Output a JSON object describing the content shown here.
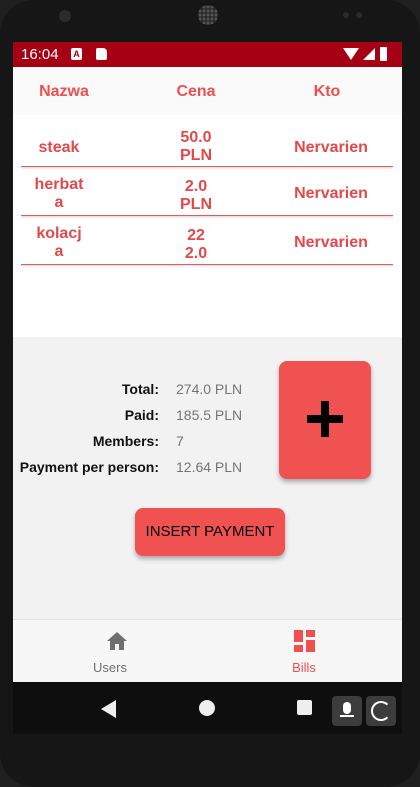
{
  "status_bar": {
    "time": "16:04"
  },
  "table": {
    "headers": [
      "Nazwa",
      "Cena",
      "Kto"
    ],
    "rows": [
      {
        "name_l1": "steak",
        "name_l2": "",
        "price_l1": "50.0",
        "price_l2": "PLN",
        "who": "Nervarien"
      },
      {
        "name_l1": "herbat",
        "name_l2": "a",
        "price_l1": "2.0",
        "price_l2": "PLN",
        "who": "Nervarien"
      },
      {
        "name_l1": "kolacj",
        "name_l2": "a",
        "price_l1": "22",
        "price_l2": "2.0",
        "who": "Nervarien"
      }
    ]
  },
  "summary": {
    "total_label": "Total:",
    "total_value": "274.0 PLN",
    "paid_label": "Paid:",
    "paid_value": "185.5 PLN",
    "members_label": "Members:",
    "members_value": "7",
    "per_person_label": "Payment per person:",
    "per_person_value": "12.64 PLN"
  },
  "buttons": {
    "add_icon": "plus-icon",
    "insert_label": "INSERT PAYMENT"
  },
  "bottom_nav": {
    "items": [
      {
        "label": "Users",
        "icon": "home-icon",
        "active": false,
        "color": "#6f6f6f"
      },
      {
        "label": "Bills",
        "icon": "dashboard-icon",
        "active": true,
        "color": "#ef4f4f"
      }
    ]
  },
  "colors": {
    "accent": "#f05151",
    "status_bar": "#a50013",
    "header_text": "#ef4f4f"
  }
}
